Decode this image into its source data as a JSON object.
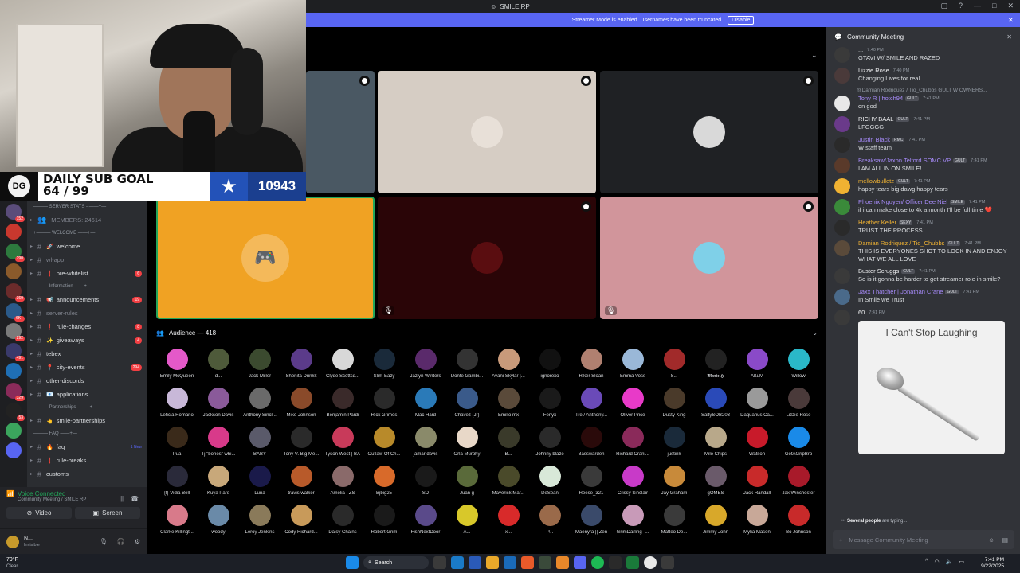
{
  "window": {
    "title": "SMILE RP",
    "controls": [
      "▢",
      "?",
      "—",
      "□",
      "✕"
    ]
  },
  "banner": {
    "text": "Streamer Mode is enabled. Usernames have been truncated.",
    "button": "Disable"
  },
  "overlay": {
    "goal_label": "DAILY SUB GOAL",
    "goal_progress": "64 / 99",
    "logo": "DG",
    "count": "10943"
  },
  "rail": {
    "servers": [
      {
        "badge": "152",
        "color": "#5a4c7a"
      },
      {
        "badge": "",
        "color": "#c9382e"
      },
      {
        "badge": "290",
        "color": "#2d7a3e"
      },
      {
        "badge": "",
        "color": "#8a5a2b"
      },
      {
        "badge": "369",
        "color": "#6b2b2b"
      },
      {
        "badge": "6K+",
        "color": "#2b5a8a"
      },
      {
        "badge": "292",
        "color": "#7a7a7a"
      },
      {
        "badge": "491",
        "color": "#3a3a6b"
      },
      {
        "badge": "",
        "color": "#1f6fb5"
      },
      {
        "badge": "329",
        "color": "#8a2b5a"
      },
      {
        "badge": "53",
        "color": "#222"
      },
      {
        "badge": "",
        "color": "#3ba55d"
      },
      {
        "badge": "",
        "color": "#5865f2"
      }
    ]
  },
  "channels": [
    {
      "type": "cat",
      "label": "——— SERVER STATS - ——+—"
    },
    {
      "type": "stat",
      "label": "MEMBERS: 24614"
    },
    {
      "type": "cat",
      "label": "+——— WELCOME ——+—"
    },
    {
      "type": "ch",
      "emoji": "🚀",
      "label": "welcome",
      "badge": ""
    },
    {
      "type": "muted",
      "emoji": "",
      "label": "wl-app",
      "badge": ""
    },
    {
      "type": "ch",
      "emoji": "❗",
      "label": "pre-whitelist",
      "badge": "6"
    },
    {
      "type": "cat",
      "label": "——— Information ——+—"
    },
    {
      "type": "ch",
      "emoji": "📢",
      "label": "announcements",
      "badge": "19"
    },
    {
      "type": "muted",
      "emoji": "",
      "label": "server-rules",
      "badge": ""
    },
    {
      "type": "ch",
      "emoji": "❗",
      "label": "rule-changes",
      "badge": "8"
    },
    {
      "type": "ch",
      "emoji": "✨",
      "label": "giveaways",
      "badge": "4"
    },
    {
      "type": "ch",
      "emoji": "",
      "label": "tebex",
      "badge": ""
    },
    {
      "type": "ch",
      "emoji": "📍",
      "label": "city-events",
      "badge": "294"
    },
    {
      "type": "ch",
      "emoji": "",
      "label": "other-discords",
      "badge": ""
    },
    {
      "type": "ch",
      "emoji": "📧",
      "label": "applications",
      "badge": ""
    },
    {
      "type": "cat",
      "label": "——— Partnerships - ——+—"
    },
    {
      "type": "ch",
      "emoji": "👆",
      "label": "smile-partnerships",
      "badge": ""
    },
    {
      "type": "cat",
      "label": "——— FAQ ——+—"
    },
    {
      "type": "ch",
      "emoji": "🔥",
      "label": "faq",
      "new": "1 New"
    },
    {
      "type": "ch",
      "emoji": "❗",
      "label": "rule-breaks",
      "badge": ""
    },
    {
      "type": "ch",
      "emoji": "",
      "label": "customs",
      "badge": ""
    }
  ],
  "voice": {
    "title": "Voice Connected",
    "subtitle": "Community Meeting / SMILE RP",
    "video": "Video",
    "screen": "Screen"
  },
  "user": {
    "name": "N...",
    "status": "Invisible"
  },
  "stage": {
    "tiles": [
      {
        "color": "#4a5863",
        "pfp": ""
      },
      {
        "color": "#d6cdc4",
        "pfp": "#e8e0d8"
      },
      {
        "color": "#1f2124",
        "pfp": "#d9d9d9"
      },
      {
        "color": "#f0a223",
        "pfp": "discord"
      },
      {
        "color": "#2a0507",
        "pfp": "#5a0d10"
      },
      {
        "color": "#d1959b",
        "pfp": "#7fd0e8"
      }
    ]
  },
  "audience": {
    "label": "Audience — 418",
    "members": [
      {
        "name": "Emily McQueen",
        "color": "#e459c9"
      },
      {
        "name": "d...",
        "color": "#4e5a3a"
      },
      {
        "name": "Jack Miller",
        "color": "#3b4a2f"
      },
      {
        "name": "Shenita Drinkk",
        "color": "#5b3b8a"
      },
      {
        "name": "Clyde Scottsd...",
        "color": "#d8d8d8"
      },
      {
        "name": "Slim Eazy",
        "color": "#1a2a3a"
      },
      {
        "name": "Jazlyn Winters",
        "color": "#5a2a6b"
      },
      {
        "name": "Donte Gambi...",
        "color": "#333"
      },
      {
        "name": "Avani Skylar |...",
        "color": "#c89a7a"
      },
      {
        "name": "ignorexo",
        "color": "#111"
      },
      {
        "name": "Riker Sloan",
        "color": "#b08070"
      },
      {
        "name": "Emma Voss",
        "color": "#9ab8d8"
      },
      {
        "name": "S...",
        "color": "#a12a2a"
      },
      {
        "name": "𝕸𝖆𝖗𝖎𝖊 𝕳",
        "color": "#222"
      },
      {
        "name": "ÁßuM",
        "color": "#8a4ac8"
      },
      {
        "name": "Willow",
        "color": "#2ab8c8"
      },
      {
        "name": "Leticia Romano",
        "color": "#c8b8d8"
      },
      {
        "name": "Jackson Davis",
        "color": "#8a5a9a"
      },
      {
        "name": "Anthony Sincl...",
        "color": "#6a6a6a"
      },
      {
        "name": "Mike Johnson",
        "color": "#8a4a2a"
      },
      {
        "name": "Benjamin Pardi",
        "color": "#3a2a2a"
      },
      {
        "name": "Rick Grimes",
        "color": "#2a2a2a"
      },
      {
        "name": "Mac Hard",
        "color": "#2a7ab8"
      },
      {
        "name": "Chavez (Jr)",
        "color": "#3a5a8a"
      },
      {
        "name": "Emilio mx",
        "color": "#5a4a3a"
      },
      {
        "name": "Fenyx",
        "color": "#1a1a1a"
      },
      {
        "name": "Tre / Anthony...",
        "color": "#6a4ab8"
      },
      {
        "name": "Oliver Price",
        "color": "#e83ac8"
      },
      {
        "name": "Dusty King",
        "color": "#4a3a2a"
      },
      {
        "name": "SaltySOB203",
        "color": "#2a4ab8"
      },
      {
        "name": "Daquarius Ca...",
        "color": "#9a9a9a"
      },
      {
        "name": "Lizzie Rose",
        "color": "#4a3a3a"
      },
      {
        "name": "Pua",
        "color": "#3a2a1a"
      },
      {
        "name": "Tj \"bones\" whi...",
        "color": "#d83a8a"
      },
      {
        "name": "BABY",
        "color": "#5a5a6a"
      },
      {
        "name": "Tony V. Big Me...",
        "color": "#2a2a2a"
      },
      {
        "name": "Tyson West | BA",
        "color": "#c83a5a"
      },
      {
        "name": "Outlaw Of Ch...",
        "color": "#b88a2a"
      },
      {
        "name": "jamar davis",
        "color": "#8a8a6a"
      },
      {
        "name": "Orla Murphy",
        "color": "#e8d8c8"
      },
      {
        "name": "B...",
        "color": "#3a3a2a"
      },
      {
        "name": "Johnny blaze",
        "color": "#2a2a2a"
      },
      {
        "name": "Basswarden",
        "color": "#2a0a0a"
      },
      {
        "name": "Richard Crani...",
        "color": "#8a2a5a"
      },
      {
        "name": "justink",
        "color": "#1a2a3a"
      },
      {
        "name": "Milo Chips",
        "color": "#b8a88a"
      },
      {
        "name": "Watson",
        "color": "#c81a2a"
      },
      {
        "name": "GetAGripBro",
        "color": "#1a8ae8"
      },
      {
        "name": "{t} Vidia Bell",
        "color": "#2a2a3a"
      },
      {
        "name": "Kuya Pare",
        "color": "#c8a87a"
      },
      {
        "name": "Luna",
        "color": "#1a1a4a"
      },
      {
        "name": "travis walker",
        "color": "#b85a2a"
      },
      {
        "name": "Amelia | ZS",
        "color": "#8a6a6a"
      },
      {
        "name": "Bjbig25",
        "color": "#d86a2a"
      },
      {
        "name": "SD",
        "color": "#1a1a1a"
      },
      {
        "name": "Juan g",
        "color": "#5a6a3a"
      },
      {
        "name": "Maverick Mar...",
        "color": "#4a4a2a"
      },
      {
        "name": "DeSean",
        "color": "#d8e8d8"
      },
      {
        "name": "Reese_321",
        "color": "#3a3a3a"
      },
      {
        "name": "Crissy Sinclair",
        "color": "#c83ac8"
      },
      {
        "name": "Jay Graham",
        "color": "#c88a3a"
      },
      {
        "name": "gOMES",
        "color": "#6a5a6a"
      },
      {
        "name": "Jack Randall",
        "color": "#c82a2a"
      },
      {
        "name": "Jax Winchester",
        "color": "#a81a2a"
      },
      {
        "name": "Clarke Killingt...",
        "color": "#d87a8a"
      },
      {
        "name": "woody",
        "color": "#6a8aa8"
      },
      {
        "name": "Leroy Jenkins",
        "color": "#8a7a5a"
      },
      {
        "name": "Cody Richard...",
        "color": "#c89a5a"
      },
      {
        "name": "Daisy Chains",
        "color": "#2a2a2a"
      },
      {
        "name": "Robert Grim",
        "color": "#1a1a1a"
      },
      {
        "name": "FishNextDoor",
        "color": "#5a4a8a"
      },
      {
        "name": "A...",
        "color": "#d8c82a"
      },
      {
        "name": "x...",
        "color": "#d82a2a"
      },
      {
        "name": "P...",
        "color": "#9a6a4a"
      },
      {
        "name": "Maenyra || Zen",
        "color": "#3a4a6a"
      },
      {
        "name": "GrimDarling -...",
        "color": "#c89ab8"
      },
      {
        "name": "Matteo De...",
        "color": "#3a3a3a"
      },
      {
        "name": "Jimmy John",
        "color": "#d8a82a"
      },
      {
        "name": "Mylia Mason",
        "color": "#c8a898"
      },
      {
        "name": "Bo Johnson",
        "color": "#c82a2a"
      }
    ]
  },
  "chat": {
    "title": "Community Meeting",
    "messages": [
      {
        "name": "...",
        "name_color": "#dbdee1",
        "tag": "",
        "time": "7:40 PM",
        "text": "GTAVI W/ SMILE AND RAZED",
        "avatar": "#3a3a3a",
        "reply": ""
      },
      {
        "name": "Lizzie Rose",
        "name_color": "#f2f3f5",
        "tag": "",
        "time": "7:40 PM",
        "text": "Changing Lives for real",
        "avatar": "#4a3a3a",
        "reply": ""
      },
      {
        "name": "Tony R | hotch94",
        "name_color": "#a78bfa",
        "tag": "GULT",
        "time": "7:41 PM",
        "text": "on god",
        "avatar": "#e8e8e8",
        "reply": "@Damian Rodriquez / Tio_Chubbs  GULT  W OWNERS..."
      },
      {
        "name": "RICHY BAAL",
        "name_color": "#f2f3f5",
        "tag": "GULT",
        "time": "7:41 PM",
        "text": "LFGGGG",
        "avatar": "#6a3a8a",
        "reply": ""
      },
      {
        "name": "Justin Black",
        "name_color": "#a78bfa",
        "tag": "RMC",
        "time": "7:41 PM",
        "text": "W staff team",
        "avatar": "#2a2a2a",
        "reply": ""
      },
      {
        "name": "Breaksaw/Jaxon Telford SOMC VP",
        "name_color": "#a78bfa",
        "tag": "GULT",
        "time": "7:41 PM",
        "text": "I AM ALL IN ON SMILE!",
        "avatar": "#5a3a2a",
        "reply": ""
      },
      {
        "name": "mellowbulletz",
        "name_color": "#f0b232",
        "tag": "GULT",
        "time": "7:41 PM",
        "text": "happy tears big dawg happy tears",
        "avatar": "#f0b232",
        "reply": ""
      },
      {
        "name": "Phoenix Nguyen/ Officer Dee Niel",
        "name_color": "#a78bfa",
        "tag": "SMILE",
        "time": "7:41 PM",
        "text": "if i can make close to 4k a month I'll be full time ❤️",
        "avatar": "#3a8a3a",
        "reply": ""
      },
      {
        "name": "Heather Keller",
        "name_color": "#f0b232",
        "tag": "SEXY",
        "time": "7:41 PM",
        "text": "TRUST THE PROCESS",
        "avatar": "#2a2a2a",
        "reply": ""
      },
      {
        "name": "Damian Rodriquez / Tio_Chubbs",
        "name_color": "#f0b232",
        "tag": "GULT",
        "time": "7:41 PM",
        "text": "THIS IS EVERYONES SHOT TO LOCK IN AND ENJOY WHAT WE ALL LOVE",
        "avatar": "#5a4a3a",
        "reply": ""
      },
      {
        "name": "Buster Scruggs",
        "name_color": "#f2f3f5",
        "tag": "GULT",
        "time": "7:41 PM",
        "text": "So is it gonna be harder to get streamer role in smile?",
        "avatar": "#3a3a3a",
        "reply": ""
      },
      {
        "name": "Jaxx Thatcher | Jonathan Crane",
        "name_color": "#a78bfa",
        "tag": "GULT",
        "time": "7:41 PM",
        "text": "In Smile we Trust",
        "avatar": "#4a6a8a",
        "reply": ""
      },
      {
        "name": "60",
        "name_color": "#f2f3f5",
        "tag": "",
        "time": "7:41 PM",
        "text": "",
        "avatar": "#3a3a3a",
        "reply": ""
      }
    ],
    "gif_caption": "I Can't Stop Laughing",
    "typing_name": "Several people",
    "typing_text": "are typing...",
    "input_placeholder": "Message Community Meeting"
  },
  "taskbar": {
    "temp": "79°F",
    "condition": "Clear",
    "search": "Search",
    "time": "7:41 PM",
    "date": "9/22/2025"
  }
}
